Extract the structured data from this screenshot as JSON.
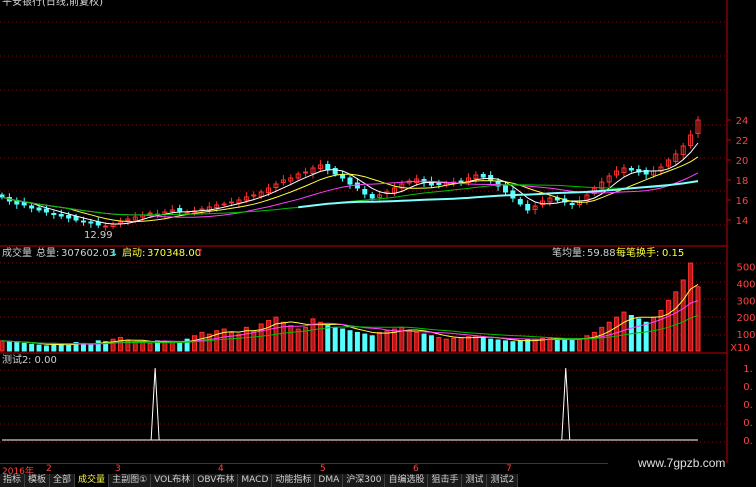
{
  "topbar": {
    "title": "平安银行(日线,前复权)"
  },
  "price_axis": {
    "ticks": [
      "24",
      "22",
      "20",
      "18",
      "16",
      "14"
    ]
  },
  "volume_header": {
    "name": "成交量",
    "total_label": "总量:",
    "total_value": "307602.03",
    "start_label": "启动:",
    "start_value": "370348.00",
    "per_trade_label": "笔均量:",
    "per_trade_value": "59.88",
    "turnover_label": "每笔换手:",
    "turnover_value": "0.15"
  },
  "volume_axis": {
    "ticks": [
      "500",
      "400",
      "300",
      "200",
      "100"
    ],
    "unit": "X10"
  },
  "indicator_header": {
    "name": "测试2",
    "value": ": 0.00"
  },
  "indicator_axis": {
    "ticks": [
      "1.",
      "0.",
      "0.",
      "0.",
      "0."
    ]
  },
  "min_price_label": "12.99",
  "timeline": {
    "year": "2016年",
    "months": [
      "2",
      "3",
      "4",
      "5",
      "6",
      "7"
    ]
  },
  "tabs": [
    "指标",
    "模板",
    "全部",
    "成交量",
    "主副图①",
    "VOL布林",
    "OBV布林",
    "MACD",
    "动能指标",
    "DMA",
    "沪深300",
    "自编选股",
    "狙击手",
    "测试",
    "测试2"
  ],
  "watermark": "www.7gpzb.com",
  "colors": {
    "up": "#ff3030",
    "down": "#54ffff",
    "grid": "#900000",
    "ma_white": "#ffffff",
    "ma_yellow": "#ffff40",
    "ma_magenta": "#ff40ff",
    "ma_green": "#00c000",
    "ma_cyan": "#80ffff"
  },
  "chart_data": {
    "type": "candlestick",
    "price_ylim": [
      12,
      25
    ],
    "candles_close": [
      16.3,
      15.9,
      15.6,
      15.5,
      15.2,
      15.0,
      14.8,
      14.6,
      14.4,
      14.2,
      14.0,
      13.8,
      13.7,
      13.5,
      13.4,
      13.6,
      13.8,
      14.1,
      14.3,
      14.5,
      14.7,
      14.6,
      14.8,
      15.0,
      14.9,
      14.8,
      14.9,
      15.1,
      15.3,
      15.5,
      15.6,
      15.8,
      16.0,
      16.3,
      16.5,
      16.8,
      17.2,
      17.6,
      18.0,
      18.2,
      18.6,
      18.8,
      19.2,
      19.5,
      19.0,
      18.6,
      18.2,
      17.6,
      17.2,
      16.6,
      16.2,
      16.5,
      16.8,
      17.2,
      17.6,
      17.9,
      18.1,
      17.8,
      17.5,
      17.6,
      17.7,
      17.8,
      17.9,
      18.2,
      18.5,
      18.3,
      18.0,
      17.4,
      16.8,
      16.2,
      15.6,
      15.0,
      15.4,
      15.9,
      16.2,
      16.0,
      15.8,
      15.6,
      15.9,
      16.5,
      17.2,
      17.8,
      18.4,
      18.9,
      19.2,
      19.0,
      18.8,
      18.6,
      18.9,
      19.3,
      20.0,
      20.6,
      21.4,
      22.5,
      24.0
    ],
    "volume_ylim": [
      0,
      550
    ],
    "volumes": [
      60,
      55,
      50,
      45,
      40,
      35,
      30,
      45,
      40,
      35,
      50,
      45,
      40,
      60,
      55,
      70,
      80,
      60,
      55,
      50,
      45,
      60,
      55,
      50,
      45,
      70,
      90,
      110,
      100,
      120,
      130,
      110,
      100,
      140,
      120,
      160,
      180,
      200,
      170,
      150,
      130,
      140,
      190,
      170,
      150,
      140,
      130,
      120,
      110,
      100,
      90,
      110,
      120,
      130,
      140,
      120,
      110,
      100,
      90,
      80,
      70,
      75,
      80,
      85,
      90,
      80,
      70,
      65,
      60,
      55,
      60,
      65,
      70,
      75,
      80,
      75,
      70,
      65,
      70,
      90,
      110,
      140,
      170,
      200,
      230,
      210,
      190,
      170,
      200,
      240,
      300,
      350,
      420,
      520,
      380
    ],
    "indicator_ylim": [
      0,
      1
    ],
    "indicator_spikes": [
      0.22,
      0.81
    ]
  }
}
